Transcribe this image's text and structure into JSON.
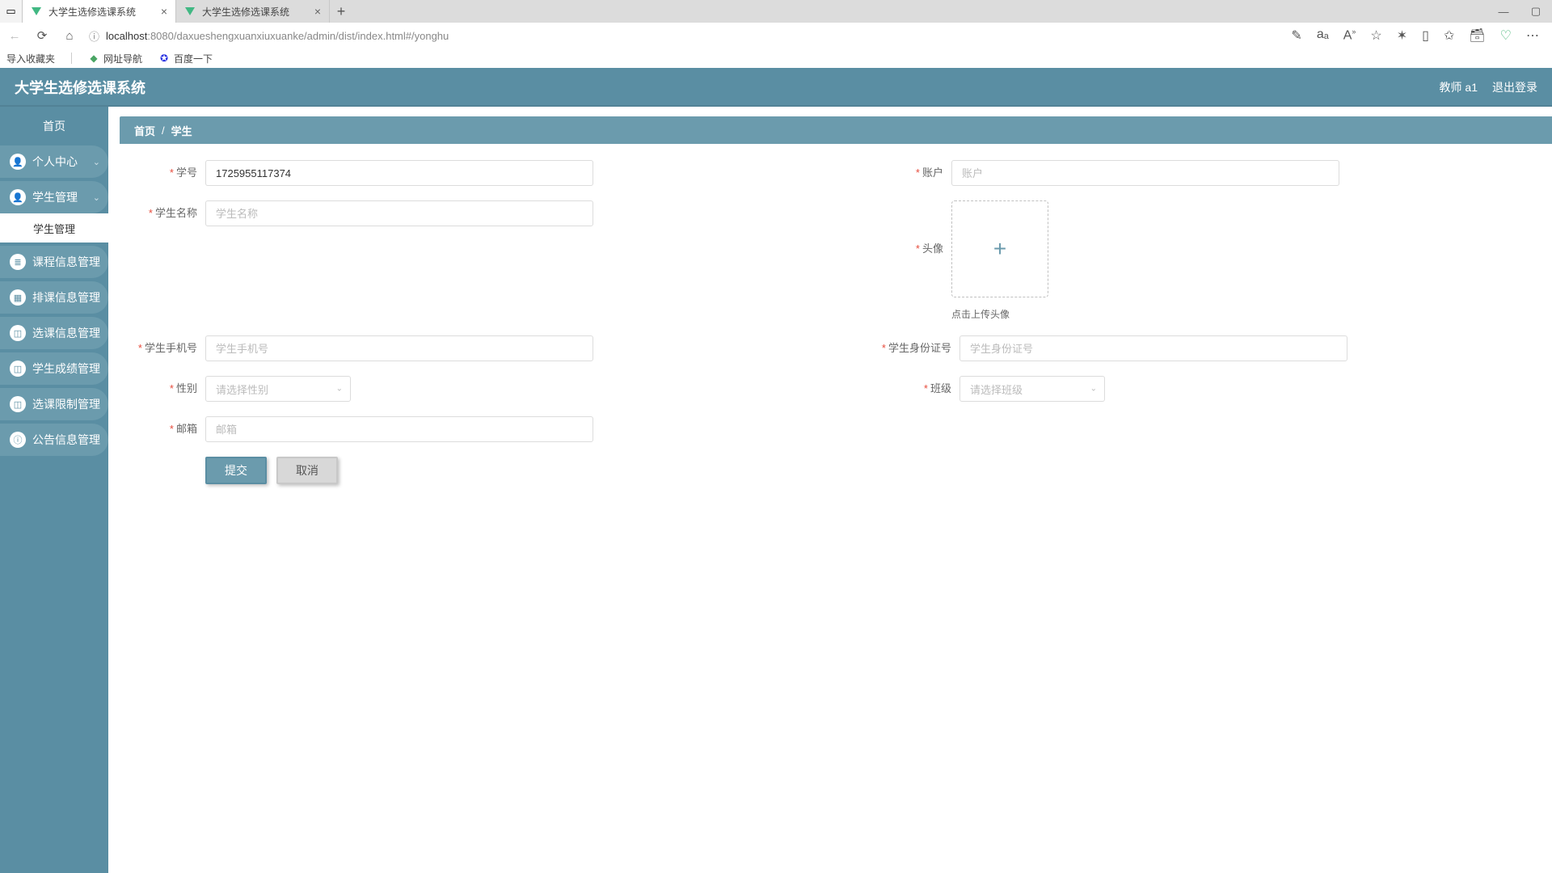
{
  "browser": {
    "tabs": [
      {
        "title": "大学生选修选课系统",
        "active": true
      },
      {
        "title": "大学生选修选课系统",
        "active": false
      }
    ],
    "url_host": "localhost",
    "url_port": ":8080",
    "url_path": "/daxueshengxuanxiuxuanke/admin/dist/index.html#/yonghu",
    "bookmarks": {
      "import": "导入收藏夹",
      "nav": "网址导航",
      "baidu": "百度一下"
    }
  },
  "app": {
    "title": "大学生选修选课系统",
    "user": "教师 a1",
    "logout": "退出登录"
  },
  "sidebar": {
    "home": "首页",
    "items": [
      {
        "label": "个人中心"
      },
      {
        "label": "学生管理"
      },
      {
        "label": "课程信息管理"
      },
      {
        "label": "排课信息管理"
      },
      {
        "label": "选课信息管理"
      },
      {
        "label": "学生成绩管理"
      },
      {
        "label": "选课限制管理"
      },
      {
        "label": "公告信息管理"
      }
    ],
    "submenu": "学生管理"
  },
  "breadcrumb": {
    "root": "首页",
    "current": "学生"
  },
  "form": {
    "student_no": {
      "label": "学号",
      "value": "1725955117374"
    },
    "account": {
      "label": "账户",
      "placeholder": "账户"
    },
    "student_name": {
      "label": "学生名称",
      "placeholder": "学生名称"
    },
    "avatar": {
      "label": "头像",
      "hint": "点击上传头像"
    },
    "phone": {
      "label": "学生手机号",
      "placeholder": "学生手机号"
    },
    "idcard": {
      "label": "学生身份证号",
      "placeholder": "学生身份证号"
    },
    "gender": {
      "label": "性别",
      "placeholder": "请选择性别"
    },
    "clazz": {
      "label": "班级",
      "placeholder": "请选择班级"
    },
    "email": {
      "label": "邮箱",
      "placeholder": "邮箱"
    },
    "submit": "提交",
    "cancel": "取消"
  }
}
